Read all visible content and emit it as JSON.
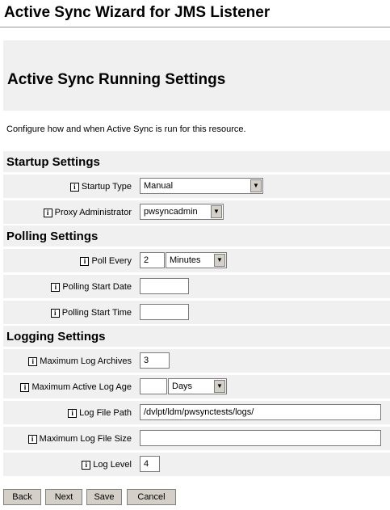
{
  "wizard_title": "Active Sync Wizard for JMS Listener",
  "page_title": "Active Sync Running Settings",
  "description": "Configure how and when Active Sync is run for this resource.",
  "info_glyph": "i",
  "sections": {
    "startup": "Startup Settings",
    "polling": "Polling Settings",
    "logging": "Logging Settings"
  },
  "fields": {
    "startup_type": {
      "label": "Startup Type",
      "value": "Manual"
    },
    "proxy_admin": {
      "label": "Proxy Administrator",
      "value": "pwsyncadmin"
    },
    "poll_every": {
      "label": "Poll Every",
      "value": "2",
      "unit": "Minutes"
    },
    "polling_start_date": {
      "label": "Polling Start Date",
      "value": ""
    },
    "polling_start_time": {
      "label": "Polling Start Time",
      "value": ""
    },
    "max_log_archives": {
      "label": "Maximum Log Archives",
      "value": "3"
    },
    "max_active_log_age": {
      "label": "Maximum Active Log Age",
      "value": "",
      "unit": "Days"
    },
    "log_file_path": {
      "label": "Log File Path",
      "value": "/dvlpt/ldm/pwsynctests/logs/"
    },
    "max_log_file_size": {
      "label": "Maximum Log File Size",
      "value": ""
    },
    "log_level": {
      "label": "Log Level",
      "value": "4"
    }
  },
  "buttons": {
    "back": "Back",
    "next": "Next",
    "save": "Save",
    "cancel": "Cancel"
  },
  "icons": {
    "dropdown": "dropdown-arrow-icon",
    "info": "info-icon"
  }
}
